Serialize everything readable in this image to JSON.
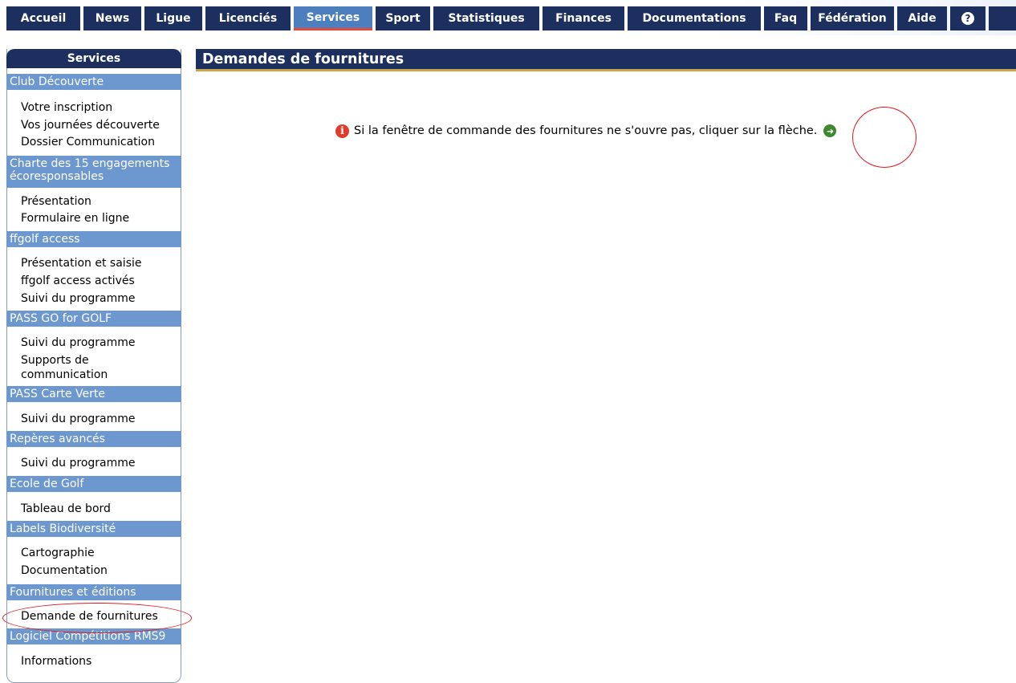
{
  "top_nav": {
    "tabs": [
      {
        "label": "Accueil",
        "active": false
      },
      {
        "label": "News",
        "active": false
      },
      {
        "label": "Ligue",
        "active": false
      },
      {
        "label": "Licenciés",
        "active": false
      },
      {
        "label": "Services",
        "active": true
      },
      {
        "label": "Sport",
        "active": false
      },
      {
        "label": "Statistiques",
        "active": false
      },
      {
        "label": "Finances",
        "active": false
      },
      {
        "label": "Documentations",
        "active": false
      },
      {
        "label": "Faq",
        "active": false
      },
      {
        "label": "Fédération",
        "active": false
      },
      {
        "label": "Aide",
        "active": false
      }
    ],
    "help_icon": "help-circle-icon"
  },
  "sidebar": {
    "title": "Services",
    "sections": [
      {
        "header": "Club Découverte",
        "links": [
          "Votre inscription",
          "Vos journées découverte",
          "Dossier Communication"
        ]
      },
      {
        "header": "Charte des 15 engagements écoresponsables",
        "links": [
          "Présentation",
          "Formulaire en ligne"
        ]
      },
      {
        "header": "ffgolf access",
        "links": [
          "Présentation et saisie",
          "ffgolf access activés",
          "Suivi du programme"
        ]
      },
      {
        "header": "PASS GO for GOLF",
        "links": [
          "Suivi du programme",
          "Supports de communication"
        ]
      },
      {
        "header": "PASS Carte Verte",
        "links": [
          "Suivi du programme"
        ]
      },
      {
        "header": "Repères avancés",
        "links": [
          "Suivi du programme"
        ]
      },
      {
        "header": "Ecole de Golf",
        "links": [
          "Tableau de bord"
        ]
      },
      {
        "header": "Labels Biodiversité",
        "links": [
          "Cartographie",
          "Documentation"
        ]
      },
      {
        "header": "Fournitures et éditions",
        "links": [
          "Demande de fournitures"
        ]
      },
      {
        "header": "Logiciel Compétitions RMS9",
        "links": [
          "Informations"
        ]
      }
    ]
  },
  "main": {
    "title": "Demandes de fournitures",
    "info_message": "Si la fenêtre de commande des fournitures ne s'ouvre pas, cliquer sur la flèche.",
    "info_icon": "info-icon",
    "arrow_icon": "arrow-right-circle-icon"
  },
  "colors": {
    "nav_bg": "#1c2f5e",
    "nav_active": "#4d7fbe",
    "section_header": "#6d97cf",
    "annotation": "#e3161c",
    "info_red": "#e23b2b",
    "arrow_green": "#3d8a2e"
  }
}
